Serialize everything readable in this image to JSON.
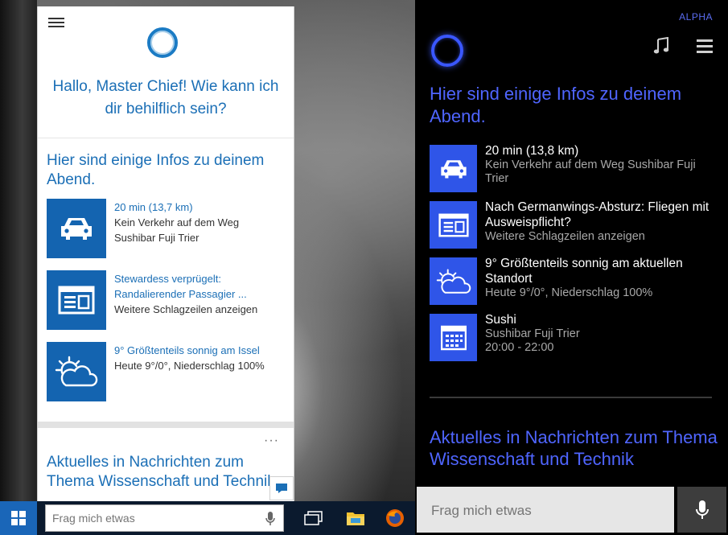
{
  "left_panel": {
    "greeting": "Hallo, Master Chief! Wie kann ich dir behilflich sein?",
    "section_title": "Hier sind einige Infos zu deinem Abend.",
    "items": [
      {
        "icon": "car-icon",
        "link": "20 min (13,7 km)",
        "sub": "Kein Verkehr auf dem Weg Sushibar Fuji Trier"
      },
      {
        "icon": "news-icon",
        "link": "Stewardess verprügelt: Randalierender Passagier ...",
        "sub": "Weitere Schlagzeilen anzeigen"
      },
      {
        "icon": "weather-icon",
        "link": "9° Größtenteils sonnig am Issel",
        "sub": "Heute 9°/0°, Niederschlag 100%"
      }
    ],
    "news_card_title": "Aktuelles in Nachrichten zum Thema Wissenschaft und Technik",
    "more_label": "···"
  },
  "taskbar": {
    "search_placeholder": "Frag mich etwas"
  },
  "right_panel": {
    "badge": "ALPHA",
    "section_title": "Hier sind einige Infos zu deinem Abend.",
    "items": [
      {
        "icon": "car-icon",
        "title": "20 min (13,8 km)",
        "sub": "Kein Verkehr auf dem Weg Sushibar Fuji Trier"
      },
      {
        "icon": "news-icon",
        "title": "Nach Germanwings-Absturz: Fliegen mit Ausweispflicht?",
        "sub": "Weitere Schlagzeilen anzeigen"
      },
      {
        "icon": "weather-icon",
        "title": "9° Größtenteils sonnig am aktuellen Standort",
        "sub": "Heute 9°/0°, Niederschlag 100%"
      },
      {
        "icon": "calendar-icon",
        "title": "Sushi",
        "sub": "Sushibar Fuji Trier",
        "sub2": "20:00 - 22:00"
      }
    ],
    "news_title": "Aktuelles in Nachrichten zum Thema Wissenschaft und Technik",
    "search_placeholder": "Frag mich etwas"
  },
  "colors": {
    "left_accent": "#1b6fb6",
    "left_tile": "#1464b0",
    "right_accent": "#4f65ff",
    "right_tile": "#2f55e8"
  }
}
